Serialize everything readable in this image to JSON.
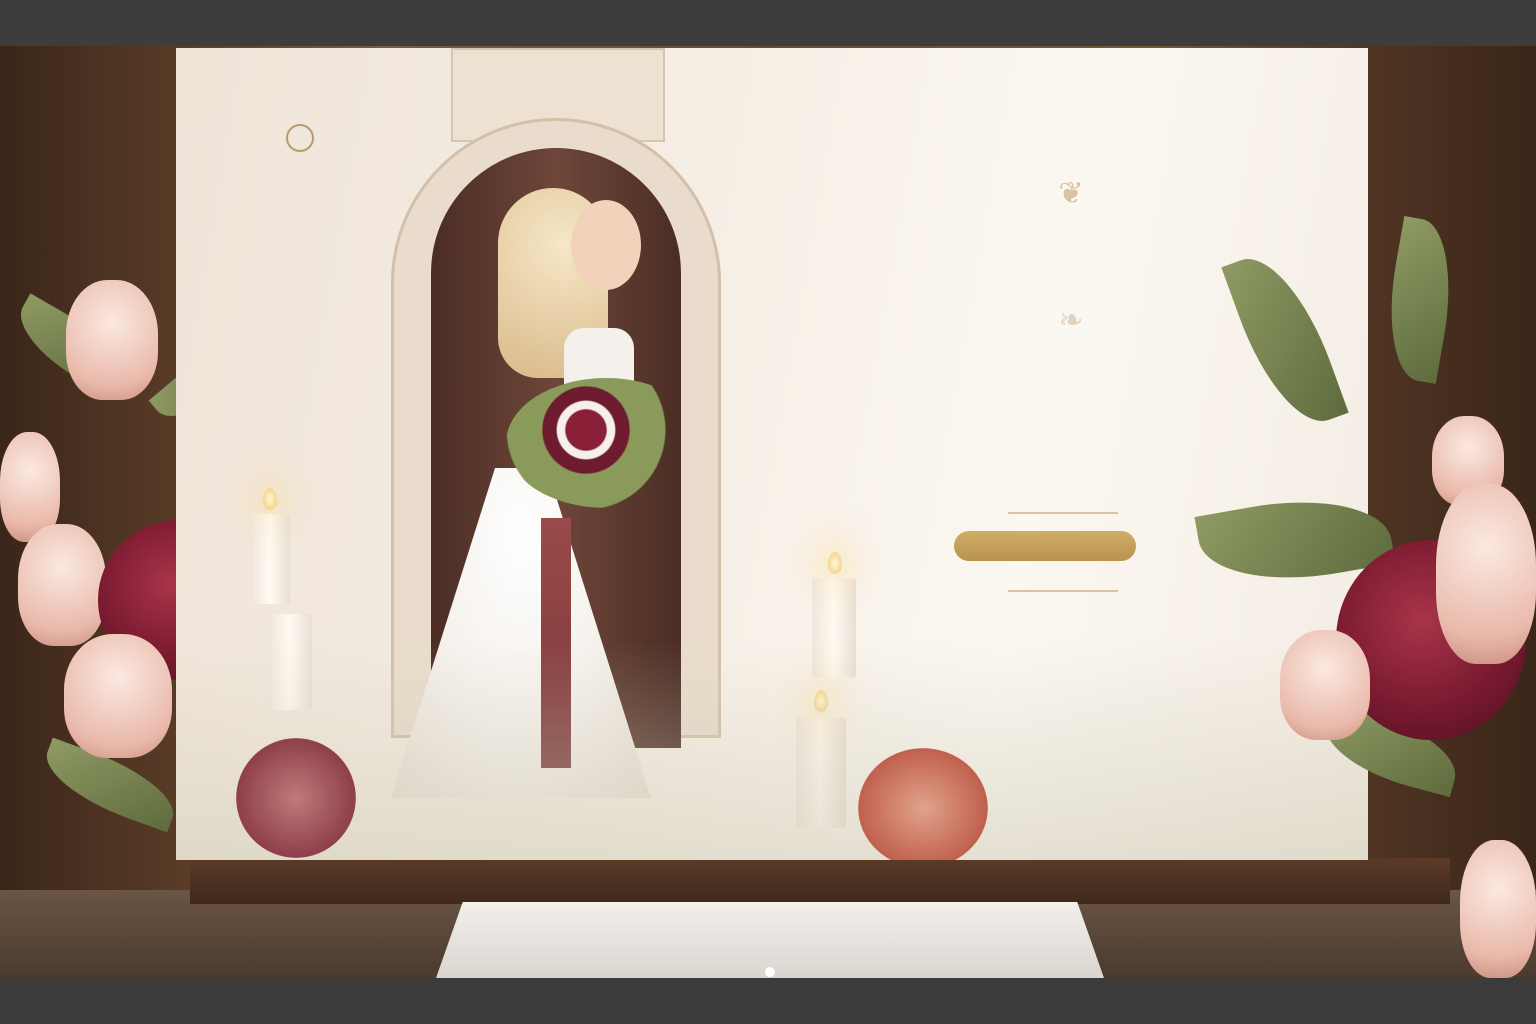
{
  "site": {
    "logo_text": "",
    "nav": [
      {
        "label": ""
      },
      {
        "label": ""
      },
      {
        "label": ""
      },
      {
        "label": ""
      }
    ],
    "hero": {
      "title_line1": "",
      "title_line2": "",
      "subtitle": "",
      "body": "",
      "caption": "",
      "cta_label": "",
      "cta_caption": ""
    }
  },
  "colors": {
    "accent_gold": "#c9a862",
    "burgundy": "#7a1a30",
    "blush": "#efc6b8",
    "cream": "#f6efe6"
  },
  "icons": {
    "logo": "monogram-logo-icon",
    "ornament": "flourish-ornament-icon"
  }
}
